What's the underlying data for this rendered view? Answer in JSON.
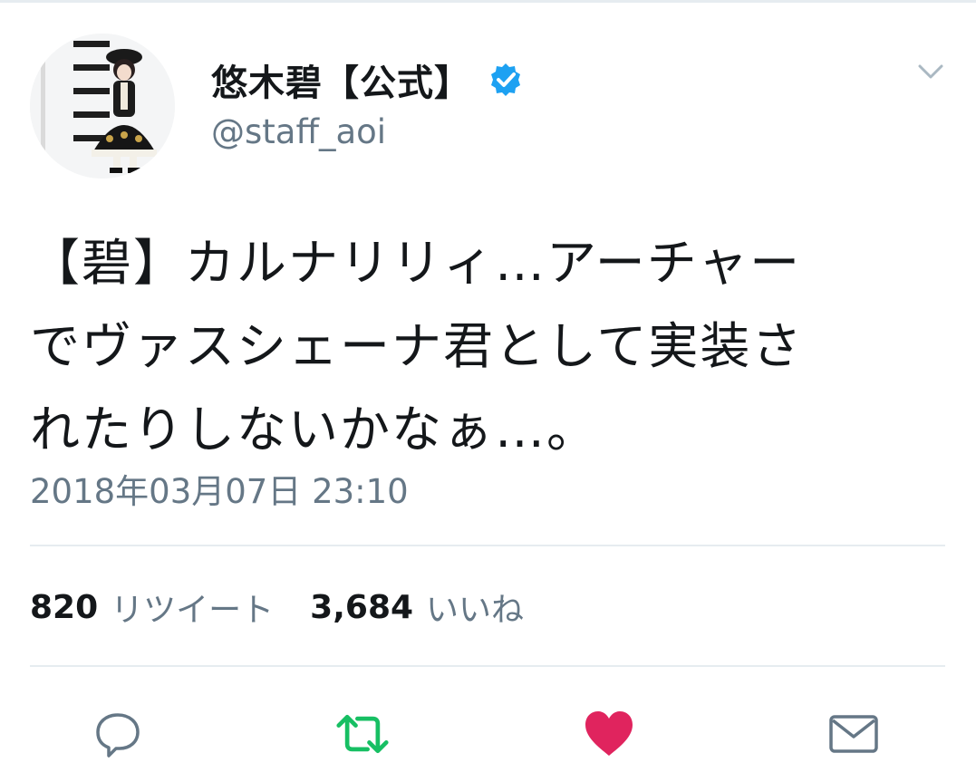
{
  "header": {
    "display_name": "悠木碧【公式】",
    "handle": "@staff_aoi"
  },
  "tweet": {
    "text": "【碧】カルナリリィ…アーチャー\nでヴァスシェーナ君として実装さ\nれたりしないかなぁ…。",
    "timestamp": "2018年03月07日 23:10"
  },
  "stats": {
    "retweet_count": "820",
    "retweet_label": "リツイート",
    "like_count": "3,684",
    "like_label": "いいね"
  },
  "icons": {
    "verified": "verified-badge-icon",
    "caret": "chevron-down-icon",
    "reply": "reply-icon",
    "retweet": "retweet-icon",
    "like": "heart-icon",
    "share": "mail-icon"
  },
  "colors": {
    "verified_blue": "#1da1f2",
    "retweet_green": "#17bf63",
    "like_red": "#e0245e",
    "secondary_text": "#657786",
    "divider": "#e6ecf0"
  }
}
